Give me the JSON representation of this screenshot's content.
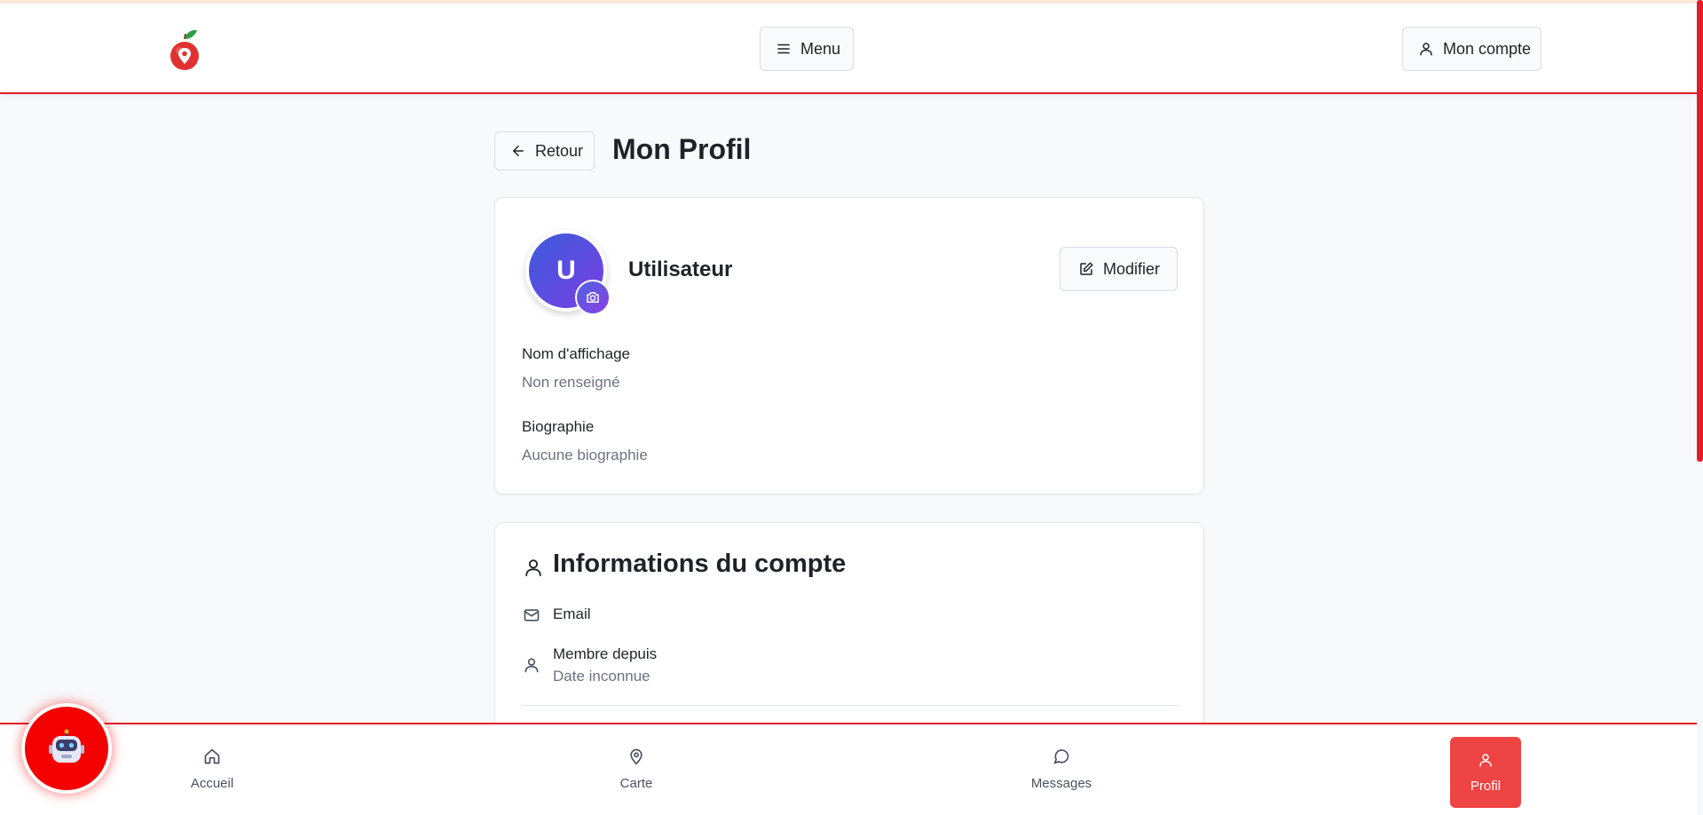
{
  "header": {
    "logo_icon": "apple-location-pin-logo",
    "menu_label": "Menu",
    "account_label": "Mon compte"
  },
  "page": {
    "back_label": "Retour",
    "title": "Mon Profil"
  },
  "profile": {
    "avatar_initial": "U",
    "username": "Utilisateur",
    "edit_label": "Modifier",
    "fields": [
      {
        "label": "Nom d'affichage",
        "value": "Non renseigné"
      },
      {
        "label": "Biographie",
        "value": "Aucune biographie"
      }
    ]
  },
  "account_info": {
    "title": "Informations du compte",
    "email_label": "Email",
    "member_label": "Membre depuis",
    "member_value": "Date inconnue"
  },
  "bottom_nav": {
    "items": [
      {
        "label": "Accueil",
        "icon": "home-icon"
      },
      {
        "label": "Carte",
        "icon": "map-pin-icon"
      },
      {
        "label": "Messages",
        "icon": "message-circle-icon"
      },
      {
        "label": "Profil",
        "icon": "user-icon"
      }
    ],
    "active": "Profil"
  },
  "colors": {
    "accent": "#e11d2a",
    "active_tab": "#ef4444",
    "avatar_gradient_start": "#3b5bdb",
    "avatar_gradient_end": "#7b3fe4",
    "chatbot": "#f50000"
  }
}
